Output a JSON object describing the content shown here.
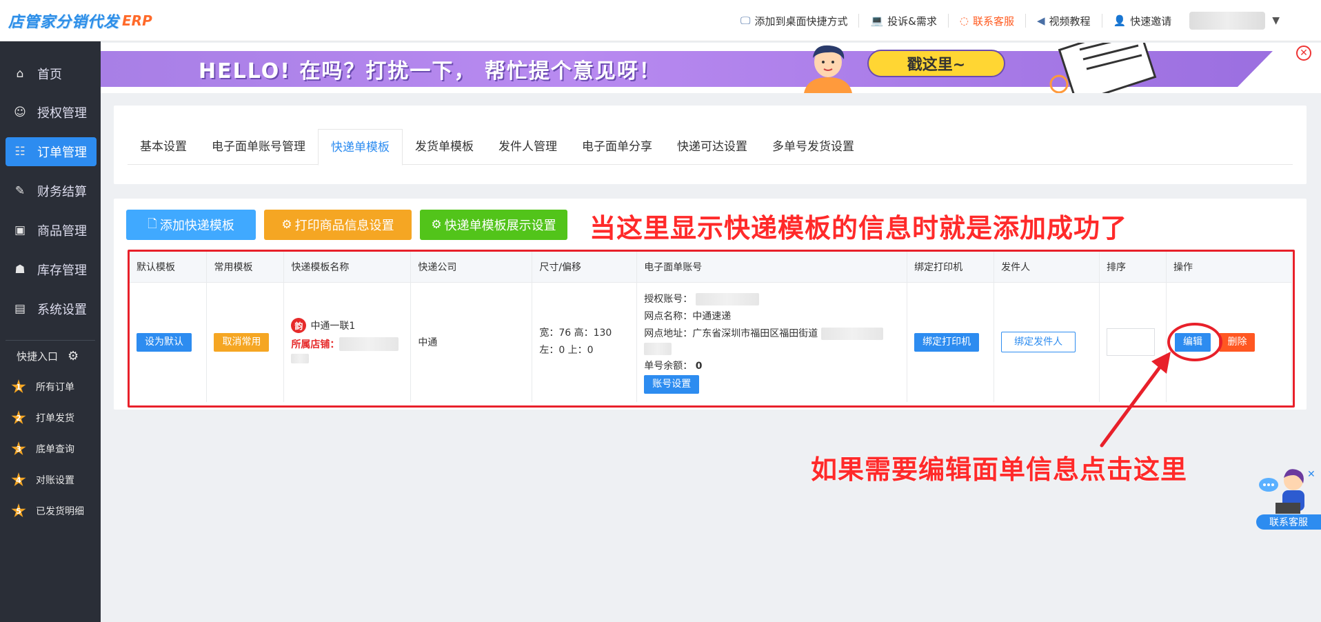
{
  "logo": {
    "cn": "店管家分销代发",
    "en": "ERP"
  },
  "topnav": [
    {
      "label": "添加到桌面快捷方式",
      "icon": "monitor-icon"
    },
    {
      "label": "投诉&需求",
      "icon": "feedback-icon"
    },
    {
      "label": "联系客服",
      "icon": "headset-icon"
    },
    {
      "label": "视频教程",
      "icon": "play-icon"
    },
    {
      "label": "快速邀请",
      "icon": "user-icon"
    }
  ],
  "sidebar": {
    "items": [
      {
        "label": "首页",
        "icon": "home-icon"
      },
      {
        "label": "授权管理",
        "icon": "user-key-icon"
      },
      {
        "label": "订单管理",
        "icon": "order-icon"
      },
      {
        "label": "财务结算",
        "icon": "finance-icon"
      },
      {
        "label": "商品管理",
        "icon": "goods-icon"
      },
      {
        "label": "库存管理",
        "icon": "warehouse-icon"
      },
      {
        "label": "系统设置",
        "icon": "settings-icon"
      }
    ],
    "active_index": 2,
    "quick_title": "快捷入口",
    "quick_items": [
      {
        "num": "1",
        "label": "所有订单"
      },
      {
        "num": "2",
        "label": "打单发货"
      },
      {
        "num": "3",
        "label": "底单查询"
      },
      {
        "num": "4",
        "label": "对账设置"
      },
      {
        "num": "5",
        "label": "已发货明细"
      }
    ]
  },
  "banner": {
    "text": "HELLO! 在吗？打扰一下，  帮忙提个意见呀！",
    "button": "戳这里~"
  },
  "tabs": [
    "基本设置",
    "电子面单账号管理",
    "快递单模板",
    "发货单模板",
    "发件人管理",
    "电子面单分享",
    "快递可达设置",
    "多单号发货设置"
  ],
  "active_tab": 2,
  "actions": {
    "add_template": "添加快递模板",
    "print_goods_settings": "打印商品信息设置",
    "template_display_settings": "快递单模板展示设置"
  },
  "annotations": {
    "top": "当这里显示快递模板的信息时就是添加成功了",
    "bottom": "如果需要编辑面单信息点击这里"
  },
  "table": {
    "headers": [
      "默认模板",
      "常用模板",
      "快递模板名称",
      "快递公司",
      "尺寸/偏移",
      "电子面单账号",
      "绑定打印机",
      "发件人",
      "排序",
      "操作"
    ],
    "row": {
      "set_default": "设为默认",
      "cancel_common": "取消常用",
      "template_badge": "韵",
      "template_name": "中通一联1",
      "shop_label": "所属店铺：",
      "company": "中通",
      "size": "宽：76 高：130",
      "offset": "左：0 上：0",
      "acct_label": "授权账号：",
      "site_name_label": "网点名称：",
      "site_name": "中通速递",
      "site_addr_label": "网点地址：",
      "site_addr": "广东省深圳市福田区福田街道",
      "balance_label": "单号余额：",
      "balance": "0",
      "acct_settings": "账号设置",
      "bind_printer": "绑定打印机",
      "bind_sender": "绑定发件人",
      "edit": "编辑",
      "delete": "删除"
    }
  },
  "service_widget": {
    "label": "联系客服"
  },
  "colors": {
    "primary": "#2d8cf0",
    "orange": "#f5a623",
    "green": "#52c41a",
    "danger": "#ff5722",
    "annotation": "#ff2a2a",
    "sidebar": "#2a2e37"
  }
}
